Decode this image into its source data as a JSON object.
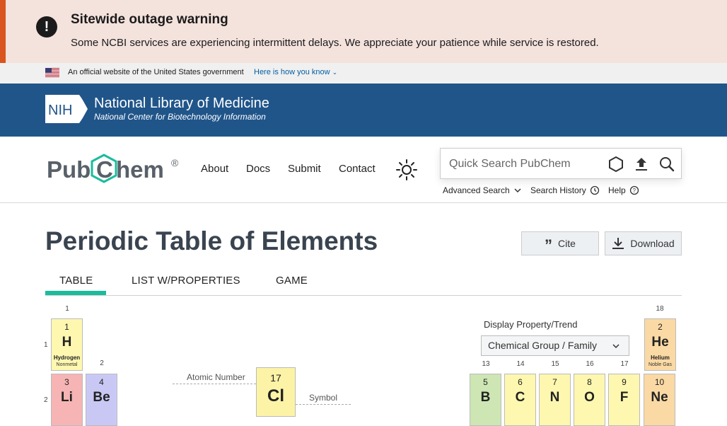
{
  "alert": {
    "icon": "exclamation-icon",
    "title": "Sitewide outage warning",
    "body": "Some NCBI services are experiencing intermittent delays. We appreciate your patience while service is restored."
  },
  "gov_banner": {
    "text": "An official website of the United States government",
    "link": "Here is how you know"
  },
  "nlm": {
    "logo_text": "NIH",
    "title": "National Library of Medicine",
    "subtitle": "National Center for Biotechnology Information"
  },
  "pubchem": {
    "logo_pre": "Pub",
    "logo_c": "C",
    "logo_post": "hem",
    "logo_reg": "®",
    "nav": [
      "About",
      "Docs",
      "Submit",
      "Contact"
    ],
    "search_placeholder": "Quick Search PubChem",
    "sublinks": [
      "Advanced Search",
      "Search History",
      "Help"
    ]
  },
  "page": {
    "title": "Periodic Table of Elements",
    "cite_label": "Cite",
    "download_label": "Download",
    "tabs": [
      "TABLE",
      "LIST W/PROPERTIES",
      "GAME"
    ],
    "active_tab": "TABLE"
  },
  "table": {
    "groups": [
      "1",
      "2",
      "13",
      "14",
      "15",
      "16",
      "17",
      "18"
    ],
    "periods": [
      "1",
      "2"
    ],
    "elements": [
      {
        "num": "1",
        "sym": "H",
        "name": "Hydrogen",
        "family": "Nonmetal",
        "color": "#fdf7b0"
      },
      {
        "num": "3",
        "sym": "Li",
        "color": "#f7b4b4"
      },
      {
        "num": "4",
        "sym": "Be",
        "color": "#c9c8f5"
      },
      {
        "num": "2",
        "sym": "He",
        "name": "Helium",
        "family": "Noble Gas",
        "color": "#fbd9a4"
      },
      {
        "num": "5",
        "sym": "B",
        "color": "#cde6b4"
      },
      {
        "num": "6",
        "sym": "C",
        "color": "#fdf7b0"
      },
      {
        "num": "7",
        "sym": "N",
        "color": "#fdf7b0"
      },
      {
        "num": "8",
        "sym": "O",
        "color": "#fdf7b0"
      },
      {
        "num": "9",
        "sym": "F",
        "color": "#fdf7b0"
      },
      {
        "num": "10",
        "sym": "Ne",
        "color": "#fbd9a4"
      }
    ],
    "legend": {
      "num": "17",
      "sym": "Cl",
      "atomic_number_label": "Atomic Number",
      "symbol_label": "Symbol"
    },
    "display_label": "Display Property/Trend",
    "display_value": "Chemical Group / Family"
  },
  "colors": {
    "alert_accent": "#d9541e",
    "nlm_blue": "#20558a",
    "pubchem_teal": "#1abc9c"
  }
}
